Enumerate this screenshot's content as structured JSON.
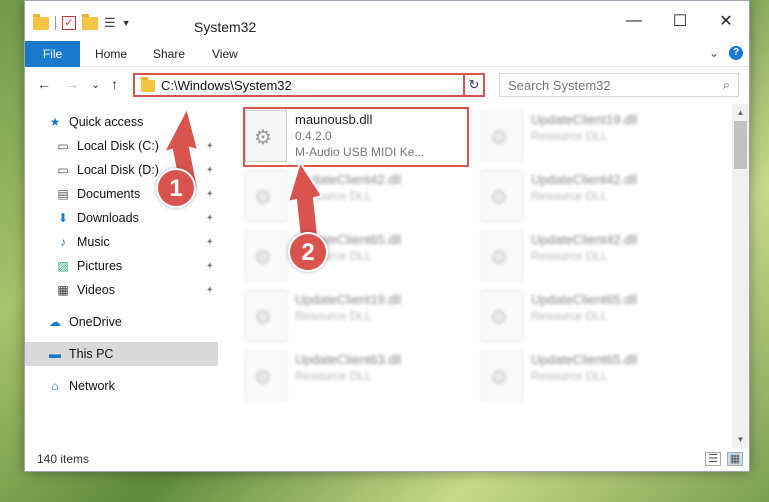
{
  "window": {
    "title": "System32",
    "controls": {
      "minimize": "—",
      "maximize": "☐",
      "close": "✕"
    }
  },
  "ribbon": {
    "tabs": [
      "File",
      "Home",
      "Share",
      "View"
    ],
    "expand": "⌄",
    "help": "?"
  },
  "nav": {
    "back": "←",
    "forward": "→",
    "recent": "⌄",
    "up": "↑",
    "address": "C:\\Windows\\System32",
    "address_dropdown": "⌄",
    "refresh": "↻",
    "search_placeholder": "Search System32",
    "search_icon": "⌕"
  },
  "sidebar": {
    "items": [
      {
        "label": "Quick access",
        "icon": "★",
        "icon_color": "#1979ca",
        "pinned": false
      },
      {
        "label": "Local Disk (C:)",
        "icon": "▭",
        "icon_color": "#555",
        "pinned": true
      },
      {
        "label": "Local Disk (D:)",
        "icon": "▭",
        "icon_color": "#555",
        "pinned": true
      },
      {
        "label": "Documents",
        "icon": "▤",
        "icon_color": "#555",
        "pinned": true
      },
      {
        "label": "Downloads",
        "icon": "⬇",
        "icon_color": "#1979ca",
        "pinned": true
      },
      {
        "label": "Music",
        "icon": "♪",
        "icon_color": "#1979ca",
        "pinned": true
      },
      {
        "label": "Pictures",
        "icon": "▨",
        "icon_color": "#3a7",
        "pinned": true
      },
      {
        "label": "Videos",
        "icon": "▦",
        "icon_color": "#333",
        "pinned": true
      },
      {
        "label": "OneDrive",
        "icon": "☁",
        "icon_color": "#1979ca",
        "pinned": false
      },
      {
        "label": "This PC",
        "icon": "▬",
        "icon_color": "#1979ca",
        "pinned": false,
        "selected": true
      },
      {
        "label": "Network",
        "icon": "⌂",
        "icon_color": "#1979ca",
        "pinned": false
      }
    ],
    "pin_glyph": "📌"
  },
  "files": [
    {
      "name": "maunousb.dll",
      "line2": "0.4.2.0",
      "line3": "M-Audio USB MIDI Ke...",
      "highlight": true
    },
    {
      "name": "UpdateClient19.dll",
      "line2": "Resource DLL"
    },
    {
      "name": "UpdateClient42.dll",
      "line2": "Resource DLL"
    },
    {
      "name": "UpdateClient42.dll",
      "line2": "Resource DLL"
    },
    {
      "name": "UpdateClient65.dll",
      "line2": "Resource DLL"
    },
    {
      "name": "UpdateClient42.dll",
      "line2": "Resource DLL"
    },
    {
      "name": "UpdateClient19.dll",
      "line2": "Resource DLL"
    },
    {
      "name": "UpdateClient65.dll",
      "line2": "Resource DLL"
    },
    {
      "name": "UpdateClient63.dll",
      "line2": "Resource DLL"
    },
    {
      "name": "UpdateClient65.dll",
      "line2": "Resource DLL"
    }
  ],
  "status": {
    "count": "140 items"
  },
  "annotations": {
    "badge1": "1",
    "badge2": "2",
    "color": "#d9534f"
  }
}
